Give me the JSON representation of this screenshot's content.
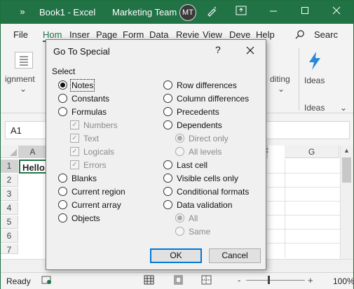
{
  "titlebar": {
    "doc_title": "Book1  -  Excel",
    "user_name": "Marketing Team",
    "avatar_initials": "MT",
    "accent": "#217346"
  },
  "tabs": [
    "File",
    "Hom",
    "Inser",
    "Page",
    "Form",
    "Data",
    "Revie",
    "View",
    "Deve",
    "Help"
  ],
  "search_label": "Searc",
  "ribbon": {
    "alignment_label": "ignment",
    "editing_label": "diting",
    "ideas_label": "Ideas",
    "ideas_group": "Ideas"
  },
  "namebox": "A1",
  "grid": {
    "columns": [
      "A",
      "F",
      "G"
    ],
    "rows": [
      "1",
      "2",
      "3",
      "4",
      "5",
      "6",
      "7"
    ],
    "a1_value": "Hello"
  },
  "status": {
    "ready": "Ready",
    "zoom": "100%",
    "minus": "-",
    "plus": "+"
  },
  "dialog": {
    "title": "Go To Special",
    "help": "?",
    "section": "Select",
    "left_options": [
      {
        "label": "Notes",
        "selected": true,
        "disabled": false
      },
      {
        "label": "Constants",
        "selected": false,
        "disabled": false
      },
      {
        "label": "Formulas",
        "selected": false,
        "disabled": false
      },
      {
        "label": "Numbers",
        "kind": "check"
      },
      {
        "label": "Text",
        "kind": "check"
      },
      {
        "label": "Logicals",
        "kind": "check"
      },
      {
        "label": "Errors",
        "kind": "check"
      },
      {
        "label": "Blanks",
        "selected": false,
        "disabled": false
      },
      {
        "label": "Current region",
        "selected": false,
        "disabled": false
      },
      {
        "label": "Current array",
        "selected": false,
        "disabled": false
      },
      {
        "label": "Objects",
        "selected": false,
        "disabled": false
      }
    ],
    "right_options": [
      {
        "label": "Row differences"
      },
      {
        "label": "Column differences"
      },
      {
        "label": "Precedents"
      },
      {
        "label": "Dependents"
      },
      {
        "label": "Direct only",
        "disabled": true,
        "selected": true
      },
      {
        "label": "All levels",
        "disabled": true
      },
      {
        "label": "Last cell"
      },
      {
        "label": "Visible cells only"
      },
      {
        "label": "Conditional formats"
      },
      {
        "label": "Data validation"
      },
      {
        "label": "All",
        "disabled": true,
        "selected": true
      },
      {
        "label": "Same",
        "disabled": true
      }
    ],
    "ok_label": "OK",
    "cancel_label": "Cancel"
  }
}
